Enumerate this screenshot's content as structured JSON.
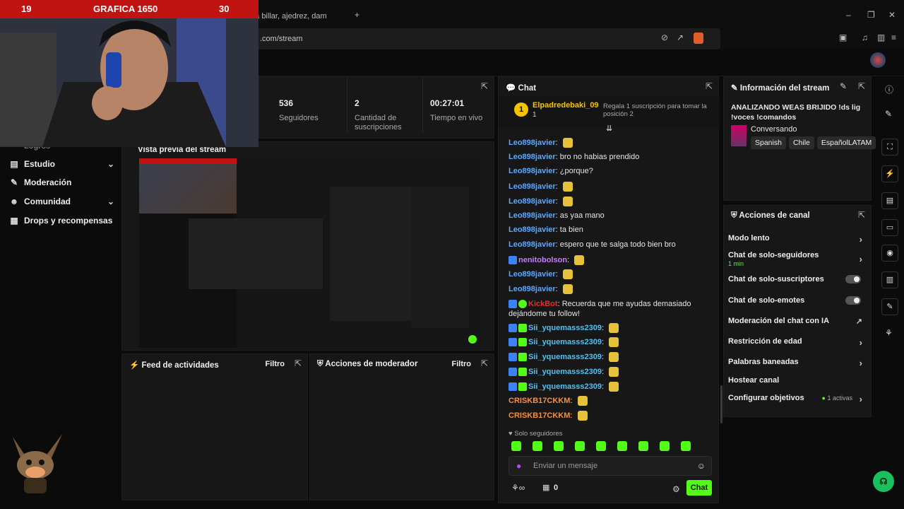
{
  "browser": {
    "tab_title": "nezer - Juega billar, ajedrez, dam",
    "url": ".com/stream"
  },
  "overlay": {
    "left_num": "19",
    "title": "GRAFICA 1650",
    "right_num": "30"
  },
  "sidebar": {
    "items": [
      {
        "label": "Estudio",
        "icon": "video-icon",
        "chevron": "⌄"
      },
      {
        "label": "Moderación",
        "icon": "wrench-icon"
      },
      {
        "label": "Comunidad",
        "icon": "users-icon",
        "chevron": "⌄"
      },
      {
        "label": "Drops y recompensas",
        "icon": "gift-icon"
      }
    ],
    "partial_item": "Logros"
  },
  "stats": [
    {
      "value": "536",
      "label": "Seguidores"
    },
    {
      "value": "2",
      "label": "Cantidad de suscripciones"
    },
    {
      "value": "00:27:01",
      "label": "Tiempo en vivo"
    }
  ],
  "preview": {
    "title": "Vista previa del stream"
  },
  "feed": {
    "title": "Feed de actividades",
    "filter": "Filtro"
  },
  "modactions": {
    "title": "Acciones de moderador",
    "filter": "Filtro"
  },
  "chat": {
    "title": "Chat",
    "pinned": {
      "rank": "1",
      "user": "Elpadredebaki_09",
      "count": "1",
      "note": "Regala 1 suscripción para tomar la posición 2"
    },
    "messages": [
      {
        "user": "Leo898javier",
        "text": "",
        "color": "#5aa8ff",
        "emote": true
      },
      {
        "user": "Leo898javier",
        "text": "bro no habias prendido",
        "color": "#5aa8ff"
      },
      {
        "user": "Leo898javier",
        "text": "¿porque?",
        "color": "#5aa8ff"
      },
      {
        "user": "Leo898javier",
        "text": "",
        "color": "#5aa8ff",
        "emote": true
      },
      {
        "user": "Leo898javier",
        "text": "",
        "color": "#5aa8ff",
        "emote": true
      },
      {
        "user": "Leo898javier",
        "text": "as yaa mano",
        "color": "#5aa8ff"
      },
      {
        "user": "Leo898javier",
        "text": "ta bien",
        "color": "#5aa8ff"
      },
      {
        "user": "Leo898javier",
        "text": "espero que te salga todo bien bro",
        "color": "#5aa8ff"
      },
      {
        "user": "nenitobolson",
        "text": "",
        "color": "#c77dff",
        "emote": true
      },
      {
        "user": "Leo898javier",
        "text": "",
        "color": "#5aa8ff",
        "emote": true
      },
      {
        "user": "Leo898javier",
        "text": "",
        "color": "#5aa8ff",
        "emote": true
      }
    ],
    "bot": {
      "user": "KickBot",
      "text": "Recuerda que me ayudas demasiado dejándome tu follow!",
      "color": "#e03131"
    },
    "messages2": [
      {
        "user": "Sii_yquemasss2309",
        "text": "",
        "color": "#53c1ef"
      },
      {
        "user": "Sii_yquemasss2309",
        "text": "",
        "color": "#53c1ef"
      },
      {
        "user": "Sii_yquemasss2309",
        "text": "",
        "color": "#53c1ef"
      },
      {
        "user": "Sii_yquemasss2309",
        "text": "",
        "color": "#53c1ef"
      },
      {
        "user": "Sii_yquemasss2309",
        "text": "",
        "color": "#53c1ef"
      },
      {
        "user": "CRISKB17CKKM",
        "text": "",
        "color": "#ff8c3a"
      },
      {
        "user": "CRISKB17CKKM",
        "text": "",
        "color": "#ff8c3a"
      }
    ],
    "followers_only": "Solo seguidores",
    "placeholder": "Enviar un mensaje",
    "counter": "0",
    "send_label": "Chat"
  },
  "info": {
    "title": "Información del stream",
    "stream_title": "ANALIZANDO WEAS BRIJIDO !ds lig !voces !comandos",
    "category": "Conversando",
    "tags": [
      "Spanish",
      "Chile",
      "EspañolLATAM"
    ]
  },
  "actions": {
    "title": "Acciones de canal",
    "rows": [
      {
        "label": "Modo lento",
        "kind": "chevron"
      },
      {
        "label": "Chat de solo-seguidores",
        "sub": "1 min",
        "kind": "chevron"
      },
      {
        "label": "Chat de solo-suscriptores",
        "kind": "toggle"
      },
      {
        "label": "Chat de solo-emotes",
        "kind": "toggle"
      },
      {
        "label": "Moderación del chat con IA",
        "kind": "external"
      },
      {
        "label": "Restricción de edad",
        "kind": "chevron"
      },
      {
        "label": "Palabras baneadas",
        "kind": "chevron"
      },
      {
        "label": "Hostear canal",
        "kind": "none"
      },
      {
        "label": "Configurar objetivos",
        "kind": "chevron",
        "badge": "1 activas"
      }
    ]
  },
  "colors": {
    "accent": "#53fc18",
    "panel": "#171717",
    "bg": "#0b0b0b"
  }
}
